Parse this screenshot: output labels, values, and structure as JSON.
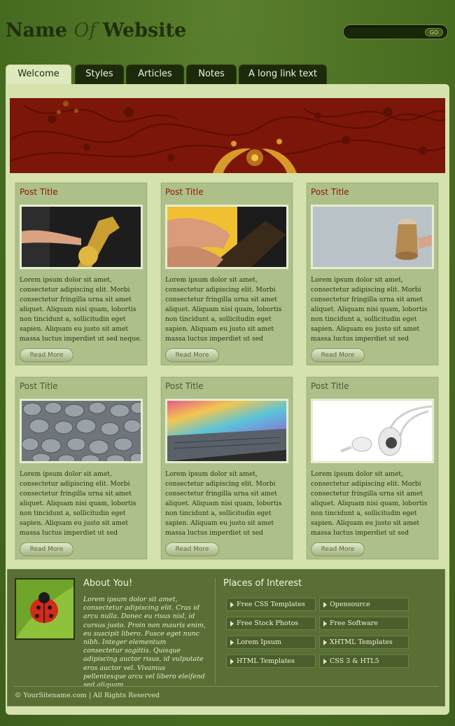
{
  "site": {
    "logo_name": "Name ",
    "logo_of": "Of",
    "logo_website": " Website"
  },
  "search": {
    "placeholder": "",
    "button": "GO"
  },
  "nav": {
    "tabs": [
      {
        "label": "Welcome"
      },
      {
        "label": "Styles"
      },
      {
        "label": "Articles"
      },
      {
        "label": "Notes"
      },
      {
        "label": "A long link text"
      }
    ]
  },
  "posts": [
    {
      "title": "Post Title",
      "image": "saxophone-photo",
      "text": "Lorem ipsum dolor sit amet, consectetur adipiscing elit. Morbi consectetur fringilla urna sit amet aliquet. Aliquam nisi quam, lobortis non tincidunt a, sollicitudin eget sapien. Aliquam eu justo sit amet massa luctus imperdiet ut sed neque.",
      "button": "Read More"
    },
    {
      "title": "Post Title",
      "image": "guitar-photo",
      "text": "Lorem ipsum dolor sit amet, consectetur adipiscing elit. Morbi consectetur fringilla urna sit amet aliquet. Aliquam nisi quam, lobortis non tincidunt a, sollicitudin eget sapien. Aliquam eu justo sit amet massa luctus imperdiet ut sed",
      "button": "Read More"
    },
    {
      "title": "Post Title",
      "image": "bongo-photo",
      "text": "Lorem ipsum dolor sit amet, consectetur adipiscing elit. Morbi consectetur fringilla urna sit amet aliquet. Aliquam nisi quam, lobortis non tincidunt a, sollicitudin eget sapien. Aliquam eu justo sit amet massa luctus imperdiet ut sed",
      "button": "Read More"
    },
    {
      "title": "Post Title",
      "image": "pebbles-photo",
      "text": "Lorem ipsum dolor sit amet, consectetur adipiscing elit. Morbi consectetur fringilla urna sit amet aliquet. Aliquam nisi quam, lobortis non tincidunt a, sollicitudin eget sapien. Aliquam eu justo sit amet massa luctus imperdiet ut sed",
      "button": "Read More"
    },
    {
      "title": "Post Title",
      "image": "laptop-photo",
      "text": "Lorem ipsum dolor sit amet, consectetur adipiscing elit. Morbi consectetur fringilla urna sit amet aliquet. Aliquam nisi quam, lobortis non tincidunt a, sollicitudin eget sapien. Aliquam eu justo sit amet massa luctus imperdiet ut sed",
      "button": "Read More"
    },
    {
      "title": "Post Title",
      "image": "earphones-photo",
      "text": "Lorem ipsum dolor sit amet, consectetur adipiscing elit. Morbi consectetur fringilla urna sit amet aliquet. Aliquam nisi quam, lobortis non tincidunt a, sollicitudin eget sapien. Aliquam eu justo sit amet massa luctus imperdiet ut sed",
      "button": "Read More"
    }
  ],
  "about": {
    "title": "About You!",
    "image": "ladybug-photo",
    "text": "Lorem ipsum dolor sit amet, consectetur adipiscing elit. Cras id arcu nulla. Donec eu risus nisl, id cursus justo. Proin non mauris enim, eu suscipit libero. Fusce eget nunc nibh. Integer elementum consectetur sagittis. Quisque adipiscing auctor risus, id vulputate eros auctor vel. Vivamus pellentesque arcu vel libero eleifend sed aliquam"
  },
  "places": {
    "title": "Places of Interest",
    "links": [
      {
        "label": "Free CSS Templates"
      },
      {
        "label": "Opensource"
      },
      {
        "label": "Free Stock Photos"
      },
      {
        "label": "Free Software"
      },
      {
        "label": "Lorem Ipsum"
      },
      {
        "label": "XHTML Templates"
      },
      {
        "label": "HTML Templates"
      },
      {
        "label": "CSS 3 & HTL5"
      }
    ]
  },
  "footer": {
    "copyright": "© YourSitename.com | All Rights Reserved"
  },
  "colors": {
    "accent": "#8a1a08",
    "background": "#4f7326",
    "panel": "#d5e2ad"
  }
}
